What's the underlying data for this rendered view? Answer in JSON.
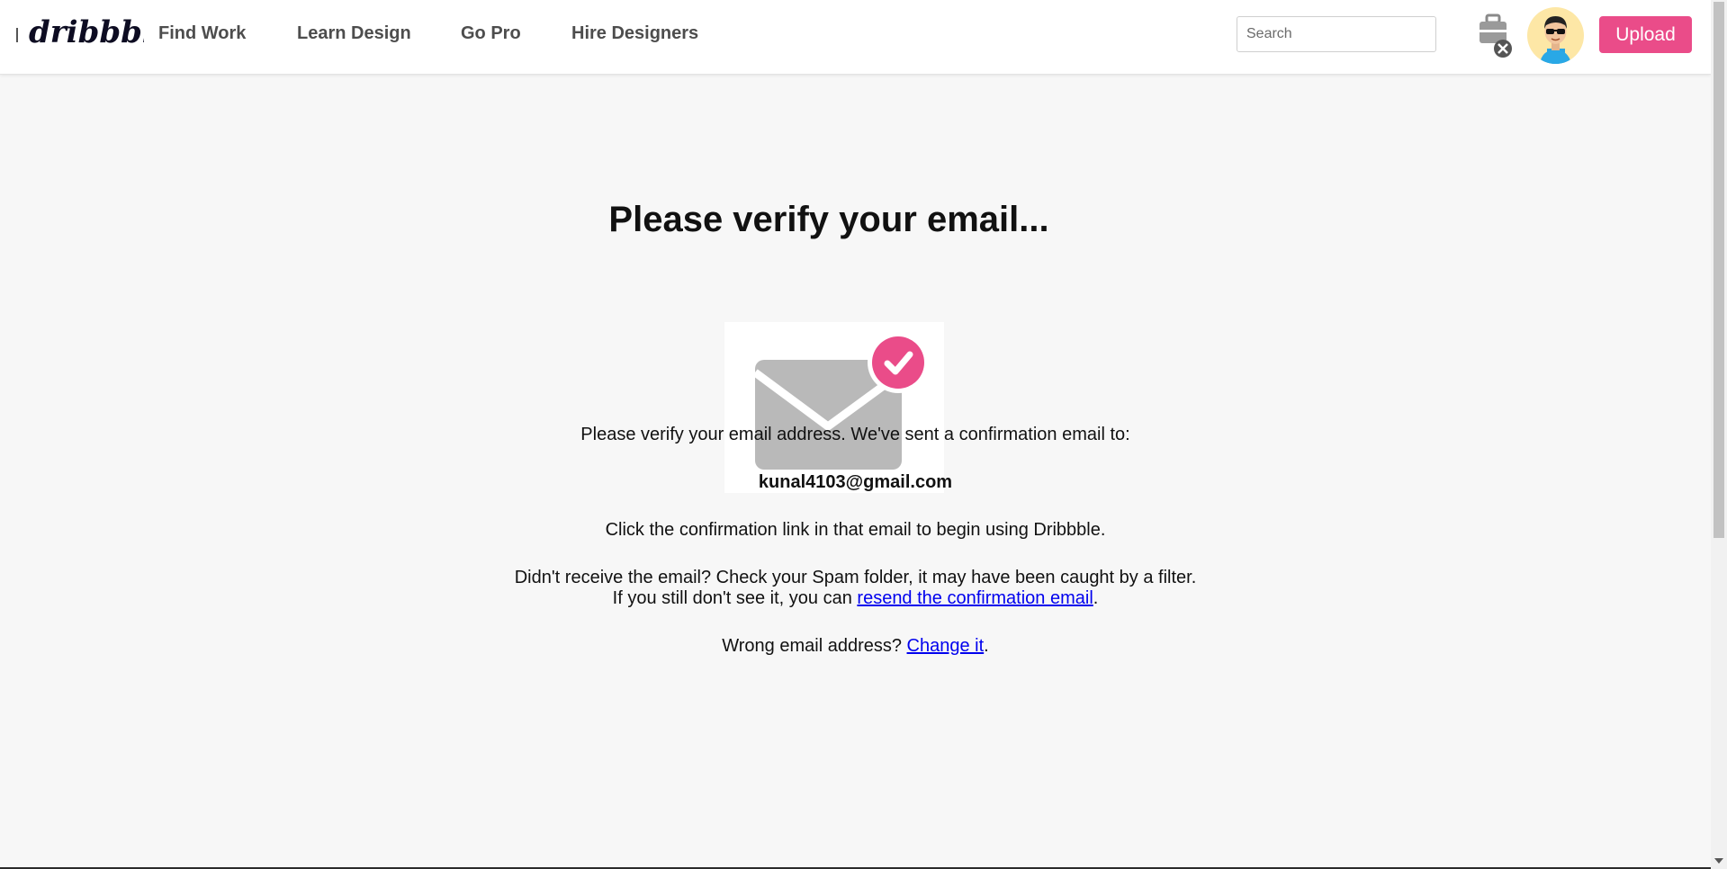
{
  "header": {
    "logo_text": "dribbble",
    "nav": [
      "Find Work",
      "Learn Design",
      "Go Pro",
      "Hire Designers"
    ],
    "search_placeholder": "Search",
    "upload_label": "Upload",
    "icons": [
      "logo",
      "jobs-briefcase-icon",
      "close-badge-icon",
      "avatar"
    ]
  },
  "main": {
    "title": "Please verify your email...",
    "line1": "Please verify your email address. We've sent a confirmation email to:",
    "email": "kunal4103@gmail.com",
    "line2": "Click the confirmation link in that email to begin using Dribbble.",
    "line3": "Didn't receive the email? Check your Spam folder, it may have been caught by a filter.",
    "line4_prefix": "If you still don't see it, you can ",
    "resend_link": "resend the confirmation email",
    "line4_suffix": ".",
    "line5_prefix": "Wrong email address? ",
    "change_link": "Change it",
    "line5_suffix": "."
  },
  "colors": {
    "accent": "#ea4c89",
    "link": "#0000ee",
    "envelope": "#b9b9b9",
    "background": "#f7f7f7"
  }
}
